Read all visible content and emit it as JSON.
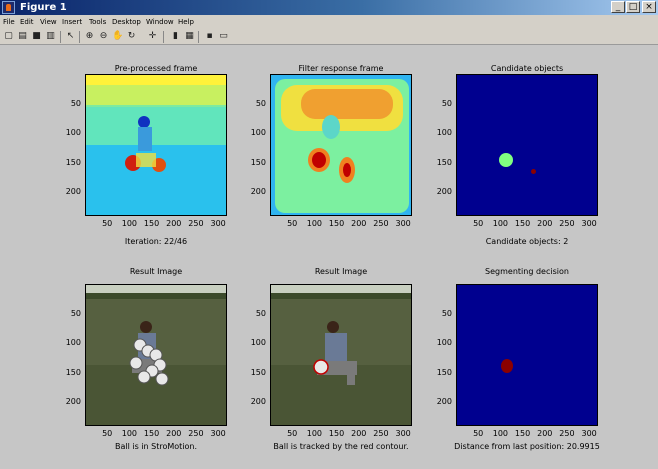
{
  "window": {
    "title": "Figure 1"
  },
  "menu": [
    "File",
    "Edit",
    "View",
    "Insert",
    "Tools",
    "Desktop",
    "Window",
    "Help"
  ],
  "toolbar_icons": [
    "new-figure-icon",
    "open-file-icon",
    "save-icon",
    "print-icon",
    "select-arrow-icon",
    "zoom-in-icon",
    "zoom-out-icon",
    "pan-icon",
    "rotate-icon",
    "data-cursor-icon",
    "colorbar-icon",
    "legend-icon",
    "hide-plot-tools-icon",
    "show-plot-tools-icon"
  ],
  "ytick_labels": [
    "50",
    "100",
    "150",
    "200"
  ],
  "xtick_labels": [
    "50",
    "100",
    "150",
    "200",
    "250",
    "300"
  ],
  "panels": [
    {
      "title": "Pre-processed frame",
      "caption": "Iteration: 22/46"
    },
    {
      "title": "Filter response frame",
      "caption": ""
    },
    {
      "title": "Candidate objects",
      "caption": "Candidate objects: 2"
    },
    {
      "title": "Result Image",
      "caption": "Ball is in StroMotion."
    },
    {
      "title": "Result Image",
      "caption": "Ball is tracked by the red contour."
    },
    {
      "title": "Segmenting decision",
      "caption": "Distance from last position: 20.9915"
    }
  ],
  "colors": {
    "jet_dark_blue": "#00008f",
    "jet_green": "#80ff80",
    "jet_red": "#8b0000",
    "grass": "#4f5a37"
  }
}
